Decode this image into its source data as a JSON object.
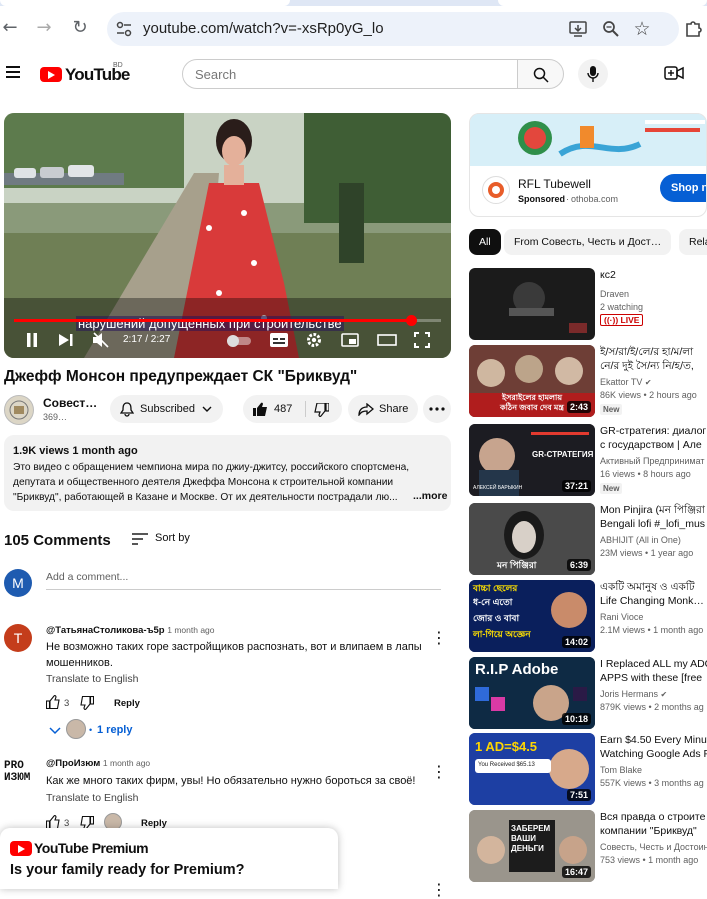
{
  "browser": {
    "url": "youtube.com/watch?v=-xsRp0yG_lo",
    "back_icon": "←",
    "forward_icon": "→",
    "reload_icon": "↻",
    "star_icon": "☆"
  },
  "header": {
    "logo_text": "YouTube",
    "country_code": "BD",
    "search_placeholder": "Search"
  },
  "player": {
    "caption": "нарушений допущенных при строительстве",
    "time": "2:17 / 2:27",
    "progress": 0.93
  },
  "video": {
    "title": "Джефф Монсон предупреждает СК \"Бриквуд\"",
    "channel_name": "Совест…",
    "channel_subs": "369…",
    "subscribed_label": "Subscribed",
    "like_count": "487",
    "share_label": "Share"
  },
  "description": {
    "meta": "1.9K views  1 month ago",
    "text": "Это видео с обращением чемпиона мира по  джиу-джитсу, российского спортсмена, депутата и общественного деятеля Джеффа Монсона к строительной компании \"Бриквуд\", работающей в Казане и Москве. От их деятельности пострадали лю...",
    "more_label": "...more"
  },
  "comments": {
    "count_label": "105 Comments",
    "sort_label": "Sort by",
    "add_placeholder": "Add a comment...",
    "my_avatar_letter": "M",
    "items": [
      {
        "avatar_letter": "T",
        "author": "@ТатьянаСтоликова-ъ5р",
        "time": "1 month ago",
        "text": "Не возможно таких горе застройщиков распознать, вот и влипаем в лапы мошенников.",
        "translate": "Translate to English",
        "likes": "3",
        "reply_label": "Reply",
        "replies_label": "1 reply"
      },
      {
        "avatar_letter": "PRO ИЗЮМ",
        "author": "@ПроИзюм",
        "time": "1 month ago",
        "text": "Как же много таких фирм, увы! Но обязательно нужно бороться за своё!",
        "translate": "Translate to English",
        "likes": "3",
        "reply_label": "Reply"
      }
    ]
  },
  "premium": {
    "logo_text": "YouTube Premium",
    "headline": "Is your family ready for Premium?"
  },
  "ad": {
    "title": "RFL Tubewell",
    "sponsored": "Sponsored",
    "domain": "othoba.com",
    "cta": "Shop no"
  },
  "chips": [
    "All",
    "From Совесть, Честь и Дост…",
    "Rela"
  ],
  "recommendations": [
    {
      "title": "кс2",
      "channel": "Draven",
      "meta": "2 watching",
      "badge": "LIVE",
      "duration": ""
    },
    {
      "title": "ই/স/রা/ই/লে/র হা/ম/লা\nনে/র দুই সৈ/ন্য নি/হ/ত,",
      "channel": "Ekattor TV",
      "meta": "86K views • 2 hours ago",
      "badge": "New",
      "duration": "2:43"
    },
    {
      "title": "GR-стратегия: диалог\nс государством | Але",
      "channel": "Активный Предпринимат",
      "meta": "16 views • 8 hours ago",
      "badge": "New",
      "duration": "37:21"
    },
    {
      "title": "Mon Pinjira (মন পিঞ্জিরা\nBengali lofi #_lofi_mus",
      "channel": "ABHIJIT (All in One)",
      "meta": "23M views • 1 year ago",
      "badge": "",
      "duration": "6:39"
    },
    {
      "title": "একটি অমানুষ ও একটি\nLife Changing Monk…",
      "channel": "Rani Vioce",
      "meta": "2.1M views • 1 month ago",
      "badge": "",
      "duration": "14:02"
    },
    {
      "title": "I Replaced ALL my ADO\nAPPS with these [free",
      "channel": "Joris Hermans",
      "meta": "879K views • 2 months ag",
      "badge": "",
      "duration": "10:18"
    },
    {
      "title": "Earn $4.50 Every Minut\nWatching Google Ads F",
      "channel": "Tom Blake",
      "meta": "557K views • 3 months ag",
      "badge": "",
      "duration": "7:51"
    },
    {
      "title": "Вся правда о строите\nкомпании \"Бриквуд\"",
      "channel": "Совесть, Честь и Достоин",
      "meta": "753 views • 1 month ago",
      "badge": "",
      "duration": "16:47"
    }
  ],
  "thumb_texts": {
    "t2": "ইসরাইলের হামলায়\nকঠিন জবাব দেব মন্ত্র",
    "t3": "GR-СТРАТЕГИЯ",
    "t3b": "АЛЕКСЕЙ БАРЫКИН",
    "t4": "মন পিঞ্জিরা",
    "t5a": "বাচ্চা ছেলের",
    "t5b": "ধ-নে এতো",
    "t5c": "জোর ও বাবা",
    "t5d": "লা-গিয়ে অজ্ঞেন",
    "t6": "R.I.P Adobe",
    "t7a": "1 AD=$4.5",
    "t7b": "You Received $65.13",
    "t8": "ЗАБЕРЕМ ВАШИ ДЕНЬГИ"
  }
}
